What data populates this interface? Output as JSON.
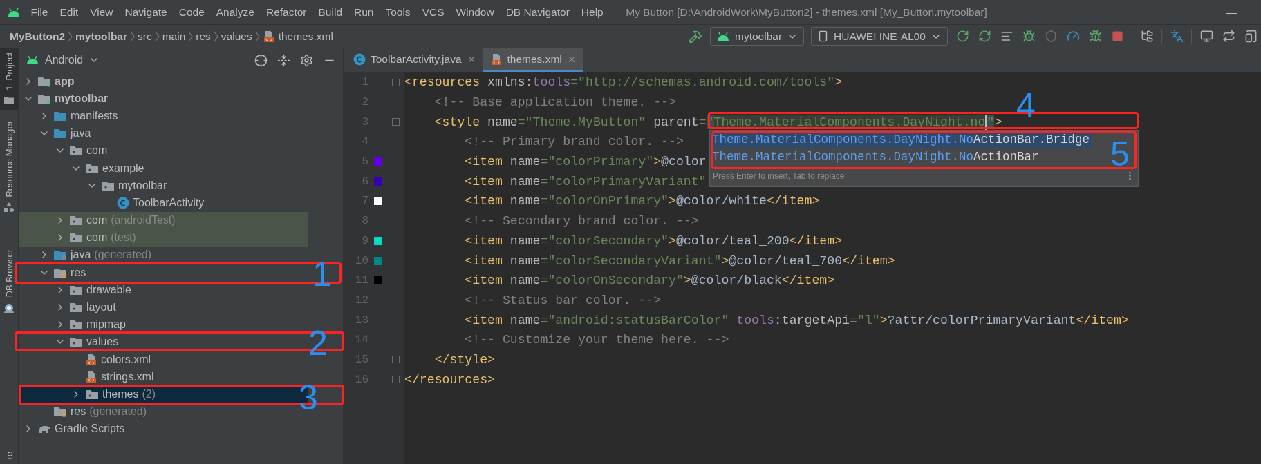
{
  "menu_bar": {
    "items": [
      "File",
      "Edit",
      "View",
      "Navigate",
      "Code",
      "Analyze",
      "Refactor",
      "Build",
      "Run",
      "Tools",
      "VCS",
      "Window",
      "DB Navigator",
      "Help"
    ],
    "window_title": "My Button [D:\\AndroidWork\\MyButton2] - themes.xml [My_Button.mytoolbar]",
    "minimize": "—"
  },
  "breadcrumbs": [
    {
      "label": "MyButton2",
      "bold": true,
      "kind": "text"
    },
    {
      "label": "mytoolbar",
      "bold": true,
      "kind": "text"
    },
    {
      "label": "src",
      "bold": false,
      "kind": "text"
    },
    {
      "label": "main",
      "bold": false,
      "kind": "text"
    },
    {
      "label": "res",
      "bold": false,
      "kind": "text"
    },
    {
      "label": "values",
      "bold": false,
      "kind": "text"
    },
    {
      "label": "themes.xml",
      "bold": false,
      "kind": "xml"
    }
  ],
  "run_toolbar": {
    "configuration": "mytoolbar",
    "device": "HUAWEI INE-AL00"
  },
  "tool_strip": [
    {
      "label": "1: Project",
      "selected": true,
      "kind": "project"
    },
    {
      "label": "Resource Manager",
      "selected": false,
      "kind": "resources"
    },
    {
      "label": "DB Browser",
      "selected": false,
      "kind": "db"
    },
    {
      "label": "re",
      "selected": false,
      "kind": "none"
    }
  ],
  "project_panel": {
    "view": "Android",
    "tree": [
      {
        "label": "app",
        "kind": "module",
        "bold": true,
        "expanded": false,
        "selected": false,
        "tinted": false
      },
      {
        "label": "mytoolbar",
        "kind": "module",
        "bold": true,
        "expanded": true,
        "selected": false,
        "tinted": false,
        "children": [
          {
            "label": "manifests",
            "kind": "source",
            "bold": false,
            "expanded": false,
            "selected": false,
            "tinted": false
          },
          {
            "label": "java",
            "kind": "source",
            "bold": false,
            "expanded": true,
            "selected": false,
            "tinted": false,
            "children": [
              {
                "label": "com",
                "kind": "package",
                "bold": false,
                "expanded": true,
                "selected": false,
                "tinted": false,
                "children": [
                  {
                    "label": "example",
                    "kind": "package",
                    "bold": false,
                    "expanded": true,
                    "selected": false,
                    "tinted": false,
                    "children": [
                      {
                        "label": "mytoolbar",
                        "kind": "package",
                        "bold": false,
                        "expanded": true,
                        "selected": false,
                        "tinted": false,
                        "children": [
                          {
                            "label": "ToolbarActivity",
                            "kind": "class",
                            "bold": false,
                            "selected": false,
                            "tinted": false
                          }
                        ]
                      }
                    ]
                  }
                ]
              },
              {
                "label": "com",
                "note": "(androidTest)",
                "kind": "package",
                "bold": false,
                "expanded": false,
                "selected": false,
                "tinted": true
              },
              {
                "label": "com",
                "note": "(test)",
                "kind": "package",
                "bold": false,
                "expanded": false,
                "selected": false,
                "tinted": true
              }
            ]
          },
          {
            "label": "java",
            "note": "(generated)",
            "kind": "generated",
            "bold": false,
            "expanded": false,
            "selected": false,
            "tinted": false
          },
          {
            "label": "res",
            "kind": "res",
            "bold": false,
            "expanded": true,
            "selected": false,
            "tinted": false,
            "children": [
              {
                "label": "drawable",
                "kind": "package",
                "bold": false,
                "expanded": false,
                "selected": false,
                "tinted": false
              },
              {
                "label": "layout",
                "kind": "package",
                "bold": false,
                "expanded": false,
                "selected": false,
                "tinted": false
              },
              {
                "label": "mipmap",
                "kind": "package",
                "bold": false,
                "expanded": false,
                "selected": false,
                "tinted": false
              },
              {
                "label": "values",
                "kind": "package",
                "bold": false,
                "expanded": true,
                "selected": false,
                "tinted": false,
                "children": [
                  {
                    "label": "colors.xml",
                    "kind": "xml",
                    "bold": false,
                    "selected": false,
                    "tinted": false
                  },
                  {
                    "label": "strings.xml",
                    "kind": "xml",
                    "bold": false,
                    "selected": false,
                    "tinted": false
                  },
                  {
                    "label": "themes",
                    "note": "(2)",
                    "kind": "package",
                    "bold": false,
                    "expanded": false,
                    "selected": true,
                    "tinted": false
                  }
                ]
              }
            ]
          },
          {
            "label": "res",
            "note": "(generated)",
            "kind": "res",
            "bold": false,
            "selected": false,
            "tinted": false
          }
        ]
      },
      {
        "label": "Gradle Scripts",
        "kind": "gradle",
        "bold": false,
        "expanded": false,
        "selected": false,
        "tinted": false
      }
    ]
  },
  "editor": {
    "tabs": [
      {
        "label": "ToolbarActivity.java",
        "kind": "class",
        "selected": false
      },
      {
        "label": "themes.xml",
        "kind": "xml",
        "selected": true
      }
    ],
    "lines": [
      {
        "number": "1",
        "fold": true,
        "tokens": [
          {
            "kind": "tag",
            "text": "<resources"
          },
          {
            "kind": "attr",
            "text": " xmlns:"
          },
          {
            "kind": "ns",
            "text": "tools"
          },
          {
            "kind": "value",
            "text": "=\"http://schemas.android.com/tools\""
          },
          {
            "kind": "tag",
            "text": ">"
          }
        ]
      },
      {
        "number": "2",
        "fold": false,
        "tokens": [
          {
            "kind": "comment",
            "text": "    <!-- Base application theme. -->"
          }
        ]
      },
      {
        "number": "3",
        "fold": true,
        "tokens": [
          {
            "kind": "tag",
            "text": "    <style"
          },
          {
            "kind": "attr",
            "text": " name"
          },
          {
            "kind": "value",
            "text": "=\"Theme.MyButton\""
          },
          {
            "kind": "attr",
            "text": " parent"
          },
          {
            "kind": "value",
            "text": "="
          },
          {
            "kind": "quote",
            "text": "\""
          },
          {
            "kind": "typed",
            "text": "Theme.MaterialComponents.DayNight.no"
          },
          {
            "kind": "caret"
          },
          {
            "kind": "quote",
            "text": "\""
          },
          {
            "kind": "tag",
            "text": ">"
          }
        ]
      },
      {
        "number": "4",
        "fold": false,
        "tokens": [
          {
            "kind": "comment",
            "text": "        <!-- Primary brand color. -->"
          }
        ]
      },
      {
        "number": "5",
        "fold": false,
        "color": "#6200ee",
        "tokens": [
          {
            "kind": "tag",
            "text": "        <item"
          },
          {
            "kind": "attr",
            "text": " name"
          },
          {
            "kind": "value",
            "text": "=\"colorPrimary\""
          },
          {
            "kind": "tag",
            "text": ">"
          },
          {
            "kind": "text",
            "text": "@color"
          }
        ]
      },
      {
        "number": "6",
        "fold": false,
        "color": "#3700b3",
        "tokens": [
          {
            "kind": "tag",
            "text": "        <item"
          },
          {
            "kind": "attr",
            "text": " name"
          },
          {
            "kind": "value",
            "text": "=\"colorPrimaryVariant\""
          }
        ]
      },
      {
        "number": "7",
        "fold": false,
        "color": "#ffffff",
        "tokens": [
          {
            "kind": "tag",
            "text": "        <item"
          },
          {
            "kind": "attr",
            "text": " name"
          },
          {
            "kind": "value",
            "text": "=\"colorOnPrimary\""
          },
          {
            "kind": "tag",
            "text": ">"
          },
          {
            "kind": "text",
            "text": "@color/white"
          },
          {
            "kind": "tag",
            "text": "</item>"
          }
        ]
      },
      {
        "number": "8",
        "fold": false,
        "tokens": [
          {
            "kind": "comment",
            "text": "        <!-- Secondary brand color. -->"
          }
        ]
      },
      {
        "number": "9",
        "fold": false,
        "color": "#03dac5",
        "tokens": [
          {
            "kind": "tag",
            "text": "        <item"
          },
          {
            "kind": "attr",
            "text": " name"
          },
          {
            "kind": "value",
            "text": "=\"colorSecondary\""
          },
          {
            "kind": "tag",
            "text": ">"
          },
          {
            "kind": "text",
            "text": "@color/teal_200"
          },
          {
            "kind": "tag",
            "text": "</item>"
          }
        ]
      },
      {
        "number": "10",
        "fold": false,
        "color": "#018786",
        "tokens": [
          {
            "kind": "tag",
            "text": "        <item"
          },
          {
            "kind": "attr",
            "text": " name"
          },
          {
            "kind": "value",
            "text": "=\"colorSecondaryVariant\""
          },
          {
            "kind": "tag",
            "text": ">"
          },
          {
            "kind": "text",
            "text": "@color/teal_700"
          },
          {
            "kind": "tag",
            "text": "</item>"
          }
        ]
      },
      {
        "number": "11",
        "fold": false,
        "color": "#000000",
        "tokens": [
          {
            "kind": "tag",
            "text": "        <item"
          },
          {
            "kind": "attr",
            "text": " name"
          },
          {
            "kind": "value",
            "text": "=\"colorOnSecondary\""
          },
          {
            "kind": "tag",
            "text": ">"
          },
          {
            "kind": "text",
            "text": "@color/black"
          },
          {
            "kind": "tag",
            "text": "</item>"
          }
        ]
      },
      {
        "number": "12",
        "fold": false,
        "tokens": [
          {
            "kind": "comment",
            "text": "        <!-- Status bar color. -->"
          }
        ]
      },
      {
        "number": "13",
        "fold": false,
        "tokens": [
          {
            "kind": "tag",
            "text": "        <item"
          },
          {
            "kind": "attr",
            "text": " name"
          },
          {
            "kind": "value",
            "text": "=\"android:statusBarColor\""
          },
          {
            "kind": "ns",
            "text": " tools"
          },
          {
            "kind": "attr",
            "text": ":targetApi"
          },
          {
            "kind": "value",
            "text": "=\"l\""
          },
          {
            "kind": "tag",
            "text": ">"
          },
          {
            "kind": "text",
            "text": "?attr/colorPrimaryVariant"
          },
          {
            "kind": "tag",
            "text": "</item>"
          }
        ]
      },
      {
        "number": "14",
        "fold": false,
        "tokens": [
          {
            "kind": "comment",
            "text": "        <!-- Customize your theme here. -->"
          }
        ]
      },
      {
        "number": "15",
        "fold": true,
        "tokens": [
          {
            "kind": "tag",
            "text": "    </style>"
          }
        ]
      },
      {
        "number": "16",
        "fold": true,
        "tokens": [
          {
            "kind": "tag",
            "text": "</resources>"
          }
        ]
      }
    ],
    "completion_popup": {
      "items": [
        {
          "match": "Theme.MaterialComponents.DayNight.No",
          "rest": "ActionBar.Bridge",
          "selected": true
        },
        {
          "match": "Theme.MaterialComponents.DayNight.No",
          "rest": "ActionBar",
          "selected": false
        }
      ],
      "hint": "Press Enter to insert, Tab to replace"
    }
  },
  "annotations": [
    {
      "label": "1"
    },
    {
      "label": "2"
    },
    {
      "label": "3"
    },
    {
      "label": "4"
    },
    {
      "label": "5"
    }
  ]
}
